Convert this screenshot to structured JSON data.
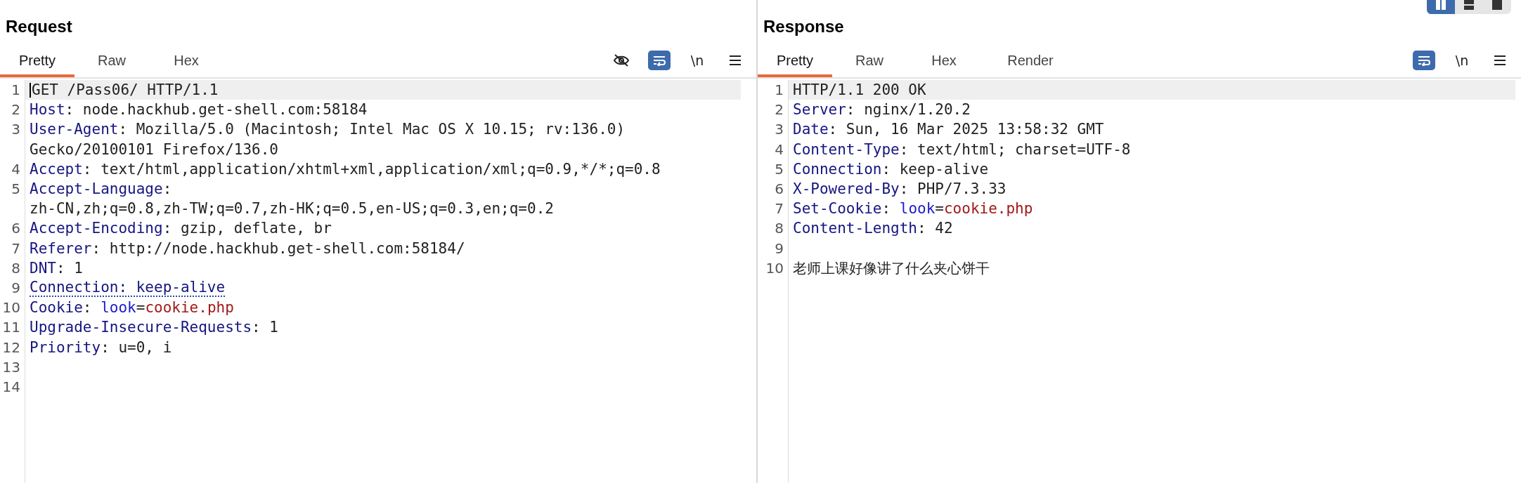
{
  "layout_buttons": [
    {
      "kind": "columns",
      "selected": true
    },
    {
      "kind": "rows",
      "selected": false
    },
    {
      "kind": "single",
      "selected": false
    }
  ],
  "panels": [
    {
      "title": "Request",
      "tabs": [
        {
          "label": "Pretty",
          "selected": true
        },
        {
          "label": "Raw",
          "selected": false
        },
        {
          "label": "Hex",
          "selected": false
        }
      ],
      "tools": [
        {
          "kind": "hide",
          "on": false
        },
        {
          "kind": "wrap",
          "on": true
        },
        {
          "kind": "newline",
          "label": "\\n",
          "on": false
        },
        {
          "kind": "menu",
          "on": false
        }
      ],
      "lines": [
        {
          "number": "1",
          "current": true,
          "rows": [
            [
              {
                "kind": "text",
                "text": "GET /Pass06/ HTTP/1.1"
              }
            ]
          ]
        },
        {
          "number": "2",
          "current": false,
          "rows": [
            [
              {
                "kind": "name",
                "text": "Host"
              },
              {
                "kind": "text",
                "text": ": node.hackhub.get-shell.com:58184"
              }
            ]
          ]
        },
        {
          "number": "3",
          "current": false,
          "rows": [
            [
              {
                "kind": "name",
                "text": "User-Agent"
              },
              {
                "kind": "text",
                "text": ": Mozilla/5.0 (Macintosh; Intel Mac OS X 10.15; rv:136.0)"
              }
            ],
            [
              {
                "kind": "text",
                "text": "Gecko/20100101 Firefox/136.0"
              }
            ]
          ]
        },
        {
          "number": "4",
          "current": false,
          "rows": [
            [
              {
                "kind": "name",
                "text": "Accept"
              },
              {
                "kind": "text",
                "text": ": text/html,application/xhtml+xml,application/xml;q=0.9,*/*;q=0.8"
              }
            ]
          ]
        },
        {
          "number": "5",
          "current": false,
          "rows": [
            [
              {
                "kind": "name",
                "text": "Accept-Language"
              },
              {
                "kind": "text",
                "text": ":"
              }
            ],
            [
              {
                "kind": "text",
                "text": "zh-CN,zh;q=0.8,zh-TW;q=0.7,zh-HK;q=0.5,en-US;q=0.3,en;q=0.2"
              }
            ]
          ]
        },
        {
          "number": "6",
          "current": false,
          "rows": [
            [
              {
                "kind": "name",
                "text": "Accept-Encoding"
              },
              {
                "kind": "text",
                "text": ": gzip, deflate, br"
              }
            ]
          ]
        },
        {
          "number": "7",
          "current": false,
          "rows": [
            [
              {
                "kind": "name",
                "text": "Referer"
              },
              {
                "kind": "text",
                "text": ": http://node.hackhub.get-shell.com:58184/"
              }
            ]
          ]
        },
        {
          "number": "8",
          "current": false,
          "rows": [
            [
              {
                "kind": "name",
                "text": "DNT"
              },
              {
                "kind": "text",
                "text": ": 1"
              }
            ]
          ]
        },
        {
          "number": "9",
          "current": false,
          "rows": [
            [
              {
                "kind": "flagged",
                "text": "Connection: keep-alive"
              }
            ]
          ]
        },
        {
          "number": "10",
          "current": false,
          "rows": [
            [
              {
                "kind": "name",
                "text": "Cookie"
              },
              {
                "kind": "text",
                "text": ": "
              },
              {
                "kind": "param",
                "text": "look"
              },
              {
                "kind": "text",
                "text": "="
              },
              {
                "kind": "value",
                "text": "cookie.php"
              }
            ]
          ]
        },
        {
          "number": "11",
          "current": false,
          "rows": [
            [
              {
                "kind": "name",
                "text": "Upgrade-Insecure-Requests"
              },
              {
                "kind": "text",
                "text": ": 1"
              }
            ]
          ]
        },
        {
          "number": "12",
          "current": false,
          "rows": [
            [
              {
                "kind": "name",
                "text": "Priority"
              },
              {
                "kind": "text",
                "text": ": u=0, i"
              }
            ]
          ]
        },
        {
          "number": "13",
          "current": false,
          "rows": [
            []
          ]
        },
        {
          "number": "14",
          "current": false,
          "rows": [
            []
          ]
        }
      ]
    },
    {
      "title": "Response",
      "tabs": [
        {
          "label": "Pretty",
          "selected": true
        },
        {
          "label": "Raw",
          "selected": false
        },
        {
          "label": "Hex",
          "selected": false
        },
        {
          "label": "Render",
          "selected": false
        }
      ],
      "tools": [
        {
          "kind": "wrap",
          "on": true
        },
        {
          "kind": "newline",
          "label": "\\n",
          "on": false
        },
        {
          "kind": "menu",
          "on": false
        }
      ],
      "lines": [
        {
          "number": "1",
          "current": true,
          "rows": [
            [
              {
                "kind": "text",
                "text": "HTTP/1.1 200 OK"
              }
            ]
          ]
        },
        {
          "number": "2",
          "current": false,
          "rows": [
            [
              {
                "kind": "name",
                "text": "Server"
              },
              {
                "kind": "text",
                "text": ": nginx/1.20.2"
              }
            ]
          ]
        },
        {
          "number": "3",
          "current": false,
          "rows": [
            [
              {
                "kind": "name",
                "text": "Date"
              },
              {
                "kind": "text",
                "text": ": Sun, 16 Mar 2025 13:58:32 GMT"
              }
            ]
          ]
        },
        {
          "number": "4",
          "current": false,
          "rows": [
            [
              {
                "kind": "name",
                "text": "Content-Type"
              },
              {
                "kind": "text",
                "text": ": text/html; charset=UTF-8"
              }
            ]
          ]
        },
        {
          "number": "5",
          "current": false,
          "rows": [
            [
              {
                "kind": "name",
                "text": "Connection"
              },
              {
                "kind": "text",
                "text": ": keep-alive"
              }
            ]
          ]
        },
        {
          "number": "6",
          "current": false,
          "rows": [
            [
              {
                "kind": "name",
                "text": "X-Powered-By"
              },
              {
                "kind": "text",
                "text": ": PHP/7.3.33"
              }
            ]
          ]
        },
        {
          "number": "7",
          "current": false,
          "rows": [
            [
              {
                "kind": "name",
                "text": "Set-Cookie"
              },
              {
                "kind": "text",
                "text": ": "
              },
              {
                "kind": "param",
                "text": "look"
              },
              {
                "kind": "text",
                "text": "="
              },
              {
                "kind": "value",
                "text": "cookie.php"
              }
            ]
          ]
        },
        {
          "number": "8",
          "current": false,
          "rows": [
            [
              {
                "kind": "name",
                "text": "Content-Length"
              },
              {
                "kind": "text",
                "text": ": 42"
              }
            ]
          ]
        },
        {
          "number": "9",
          "current": false,
          "rows": [
            []
          ]
        },
        {
          "number": "10",
          "current": false,
          "rows": [
            [
              {
                "kind": "cjk",
                "text": "老师上课好像讲了什么夹心饼干"
              }
            ]
          ]
        }
      ]
    }
  ]
}
